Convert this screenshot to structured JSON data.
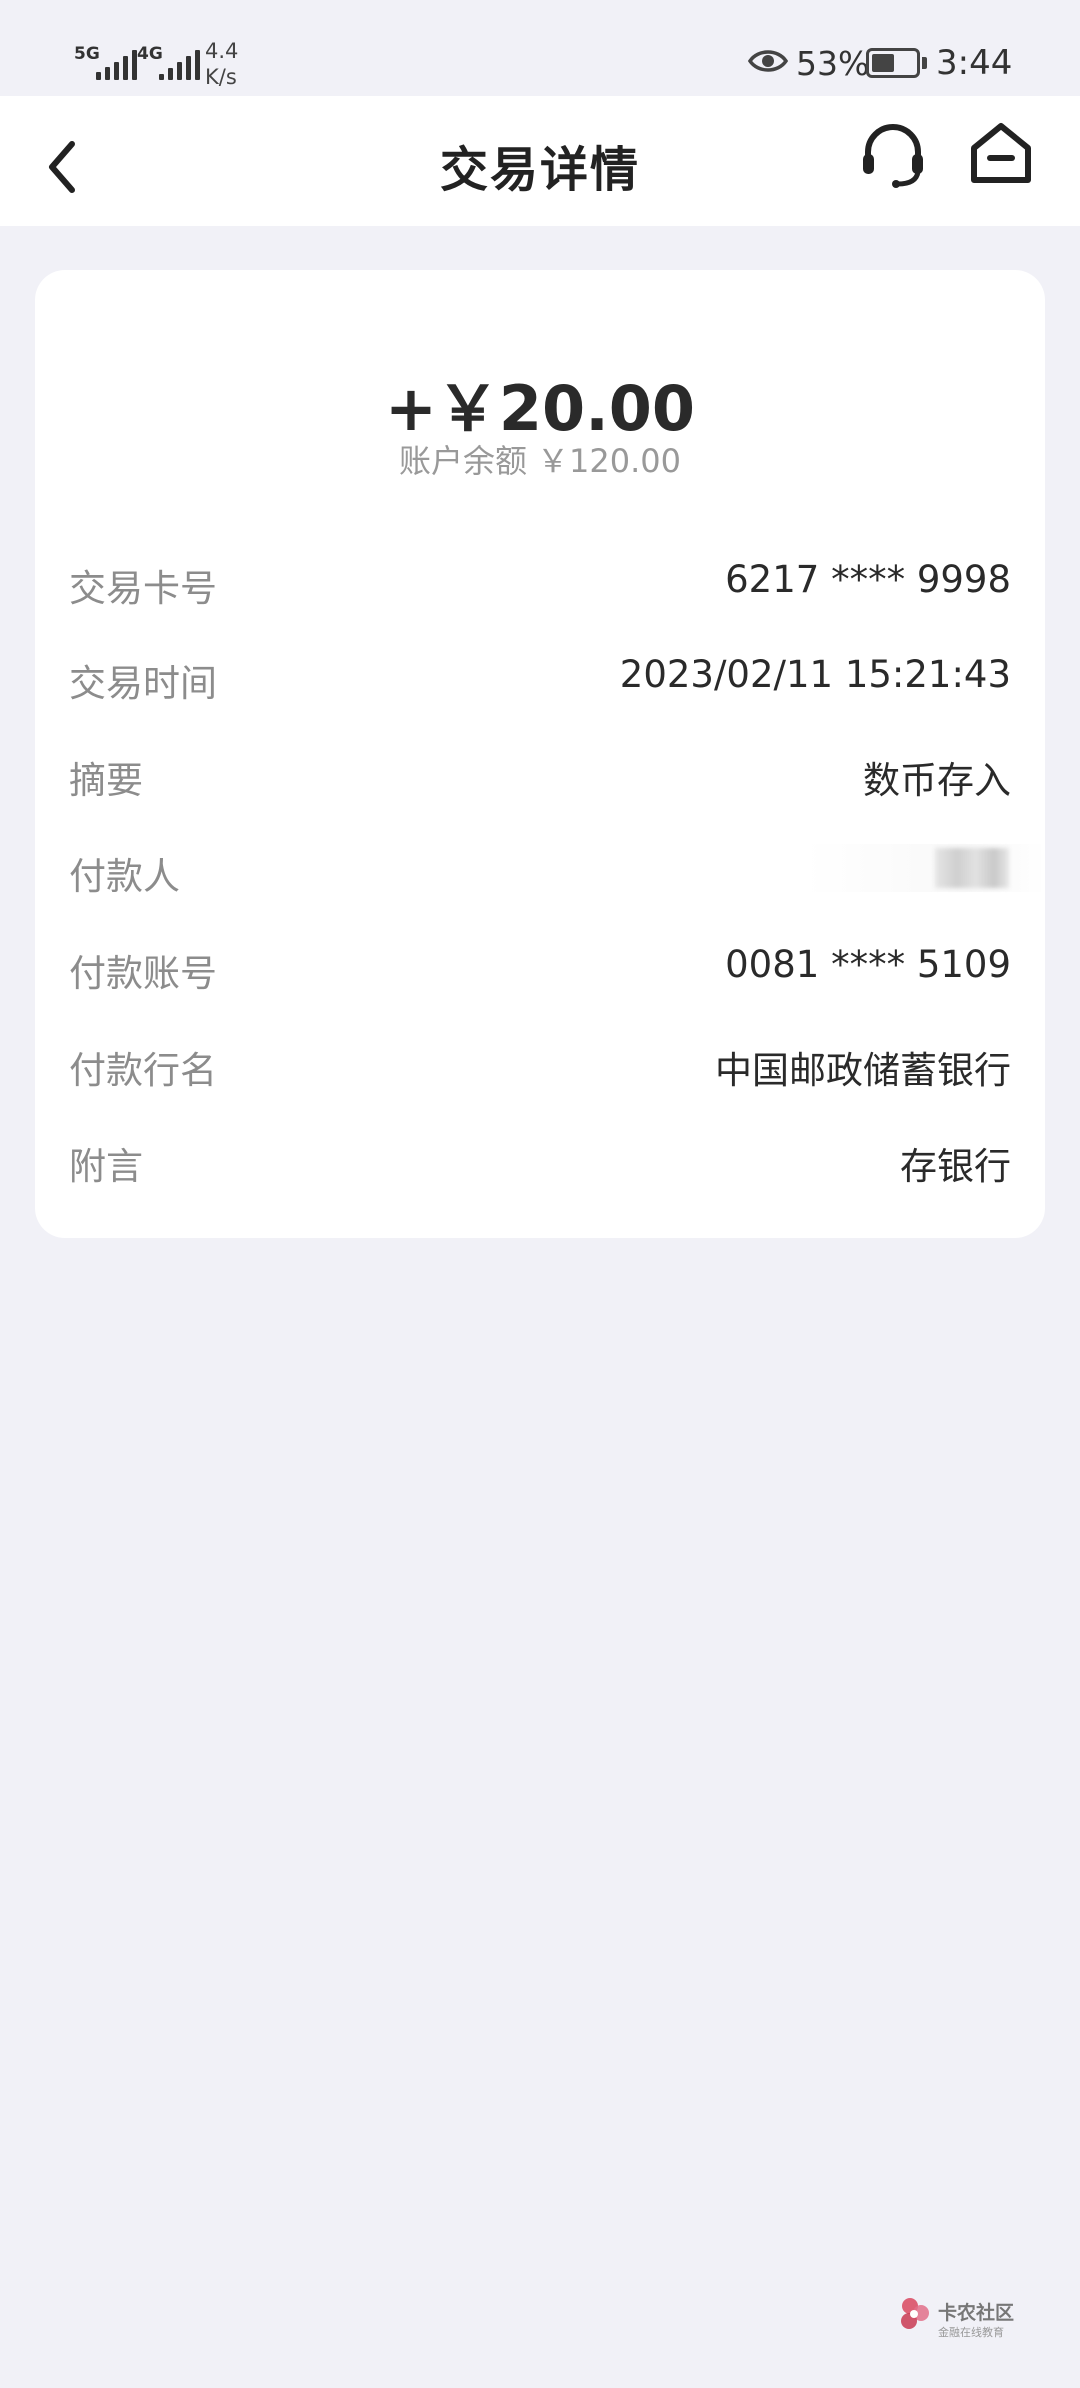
{
  "status_bar": {
    "sim1_label": "5G",
    "sim2_label": "4G",
    "network_speed_value": "4.4",
    "network_speed_unit": "K/s",
    "battery_percent": "53%",
    "battery_level": 0.53,
    "time": "3:44"
  },
  "nav": {
    "title": "交易详情"
  },
  "transaction": {
    "amount": "+￥20.00",
    "balance_label": "账户余额",
    "balance_value": "￥120.00",
    "rows": [
      {
        "label": "交易卡号",
        "value": "6217 **** 9998"
      },
      {
        "label": "交易时间",
        "value": "2023/02/11 15:21:43"
      },
      {
        "label": "摘要",
        "value": "数币存入"
      },
      {
        "label": "付款人",
        "value": ""
      },
      {
        "label": "付款账号",
        "value": "0081 **** 5109"
      },
      {
        "label": "付款行名",
        "value": "中国邮政储蓄银行"
      },
      {
        "label": "附言",
        "value": "存银行"
      }
    ]
  },
  "watermark": {
    "name": "卡农社区",
    "tagline": "金融在线教育"
  },
  "colors": {
    "page_bg": "#f1f1f7",
    "card_bg": "#ffffff",
    "label_gray": "#8c8c8c",
    "text_dark": "#2a2a2a",
    "watermark_red": "#d9485f"
  }
}
